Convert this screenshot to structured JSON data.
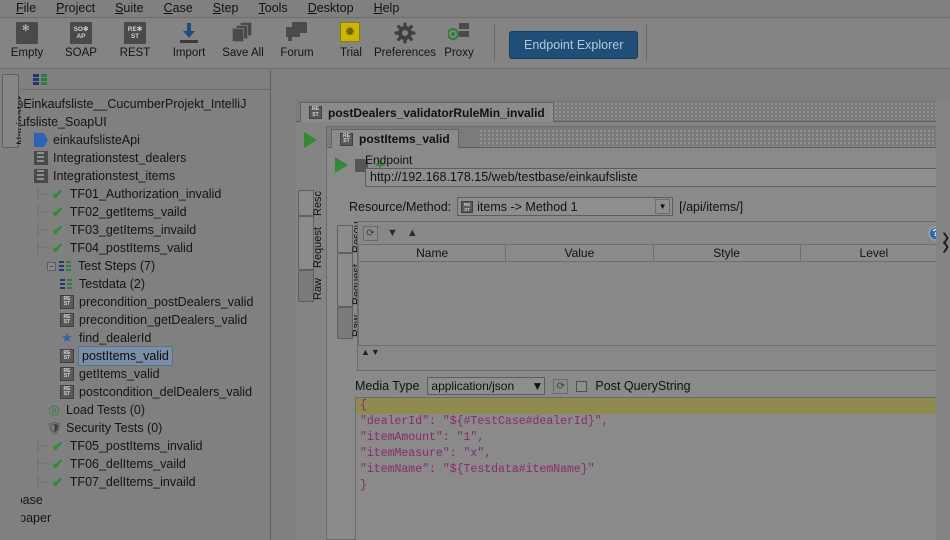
{
  "menubar": {
    "items": [
      {
        "label": "File",
        "mnemonic": "F"
      },
      {
        "label": "Project",
        "mnemonic": "P"
      },
      {
        "label": "Suite",
        "mnemonic": "S"
      },
      {
        "label": "Case",
        "mnemonic": "C"
      },
      {
        "label": "Step",
        "mnemonic": "S"
      },
      {
        "label": "Tools",
        "mnemonic": "T"
      },
      {
        "label": "Desktop",
        "mnemonic": "D"
      },
      {
        "label": "Help",
        "mnemonic": "H"
      }
    ]
  },
  "toolbar": {
    "buttons": [
      {
        "label": "Empty",
        "icon": "empty-project-icon"
      },
      {
        "label": "SOAP",
        "icon": "soap-project-icon"
      },
      {
        "label": "REST",
        "icon": "rest-project-icon"
      },
      {
        "label": "Import",
        "icon": "import-icon"
      },
      {
        "label": "Save All",
        "icon": "save-all-icon"
      },
      {
        "label": "Forum",
        "icon": "forum-icon"
      },
      {
        "label": "Trial",
        "icon": "trial-icon"
      },
      {
        "label": "Preferences",
        "icon": "gear-icon"
      },
      {
        "label": "Proxy",
        "icon": "proxy-icon"
      }
    ],
    "endpoint_explorer_label": "Endpoint Explorer",
    "accent_color": "#1f4f79"
  },
  "navigator": {
    "tab_label": "Navigator",
    "toolbar_icon": "test-steps-icon",
    "tree": [
      {
        "label": "emoEinkaufsliste__CucumberProjekt_IntelliJ",
        "icon": "none",
        "indent": 0,
        "truncated": true
      },
      {
        "label": "nkaufsliste_SoapUI",
        "icon": "none",
        "indent": 0,
        "truncated": true
      },
      {
        "label": "einkaufslisteApi",
        "icon": "interface-icon",
        "indent": 1
      },
      {
        "label": "Integrationstest_dealers",
        "icon": "testsuite-icon",
        "indent": 1
      },
      {
        "label": "Integrationstest_items",
        "icon": "testsuite-icon",
        "indent": 1
      },
      {
        "label": "TF01_Authorization_invalid",
        "icon": "check-icon",
        "indent": 1,
        "guide": true
      },
      {
        "label": "TF02_getItems_vaild",
        "icon": "check-icon",
        "indent": 1,
        "guide": true
      },
      {
        "label": "TF03_getItems_invaild",
        "icon": "check-icon",
        "indent": 1,
        "guide": true
      },
      {
        "label": "TF04_postItems_valid",
        "icon": "check-icon",
        "indent": 1,
        "guide": true
      },
      {
        "label": "Test Steps (7)",
        "icon": "test-steps-icon",
        "indent": 2,
        "expander": "−"
      },
      {
        "label": "Testdata (2)",
        "icon": "test-steps-icon",
        "indent": 3
      },
      {
        "label": "precondition_postDealers_valid",
        "icon": "rest-request-icon",
        "indent": 3
      },
      {
        "label": "precondition_getDealers_valid",
        "icon": "rest-request-icon",
        "indent": 3
      },
      {
        "label": "find_dealerId",
        "icon": "property-transfer-icon",
        "indent": 3
      },
      {
        "label": "postItems_valid",
        "icon": "rest-request-icon",
        "indent": 3,
        "selected": true
      },
      {
        "label": "getItems_valid",
        "icon": "rest-request-icon",
        "indent": 3
      },
      {
        "label": "postcondition_delDealers_valid",
        "icon": "rest-request-icon",
        "indent": 3
      },
      {
        "label": "Load Tests (0)",
        "icon": "load-test-icon",
        "indent": 2
      },
      {
        "label": "Security Tests (0)",
        "icon": "security-test-icon",
        "indent": 2
      },
      {
        "label": "TF05_postItems_invalid",
        "icon": "check-icon",
        "indent": 1,
        "guide": true
      },
      {
        "label": "TF06_delItems_vaild",
        "icon": "check-icon",
        "indent": 1,
        "guide": true
      },
      {
        "label": "TF07_delItems_invaild",
        "icon": "check-icon",
        "indent": 1,
        "guide": true
      },
      {
        "label": "estbase",
        "icon": "none",
        "indent": 0,
        "truncated": true
      },
      {
        "label": "hitepaper",
        "icon": "none",
        "indent": 0,
        "truncated": true
      }
    ]
  },
  "editor": {
    "outer_tab": {
      "label": "postDealers_validatorRuleMin_invalid",
      "icon": "rest-request-icon"
    },
    "inner_tab": {
      "label": "postItems_valid",
      "icon": "rest-request-icon"
    },
    "vertical_tabs_outer": [
      {
        "label": "Resc",
        "truncated": true
      },
      {
        "label": "Request",
        "active": false
      },
      {
        "label": "Raw",
        "active": true
      }
    ],
    "vertical_tabs_inner": [
      {
        "label": "Resou",
        "truncated": true
      },
      {
        "label": "Request",
        "active": false
      },
      {
        "label": "Raw",
        "active": true
      }
    ],
    "endpoint_label": "Endpoint",
    "endpoint_value": "http://192.168.178.15/web/testbase/einkaufsliste",
    "run_button": "run-icon",
    "stop_button": "stop-icon",
    "add_button": "add-icon",
    "resource_method_label": "Resource/Method:",
    "resource_method_value": "items -> Method 1",
    "resource_path": "[/api/items/]",
    "params_table": {
      "columns": [
        "Name",
        "Value",
        "Style",
        "Level"
      ],
      "rows": []
    },
    "media_type_label": "Media Type",
    "media_type_value": "application/json",
    "post_querystring_label": "Post QueryString",
    "post_querystring_checked": false,
    "request_body_lines": [
      {
        "text": "{",
        "highlighted": true
      },
      {
        "text": "\"dealerId\": \"${#TestCase#dealerId}\",",
        "highlighted": false
      },
      {
        "text": "\"itemAmount\": \"1\",",
        "highlighted": false
      },
      {
        "text": "\"itemMeasure\": \"x\",",
        "highlighted": false
      },
      {
        "text": "\"itemName\": \"${Testdata#itemName}\"",
        "highlighted": false
      },
      {
        "text": "}",
        "highlighted": false
      }
    ],
    "help_icon": "help-icon",
    "body_highlight_color": "#8f8a4d",
    "body_text_color": "#8a2a6b"
  }
}
